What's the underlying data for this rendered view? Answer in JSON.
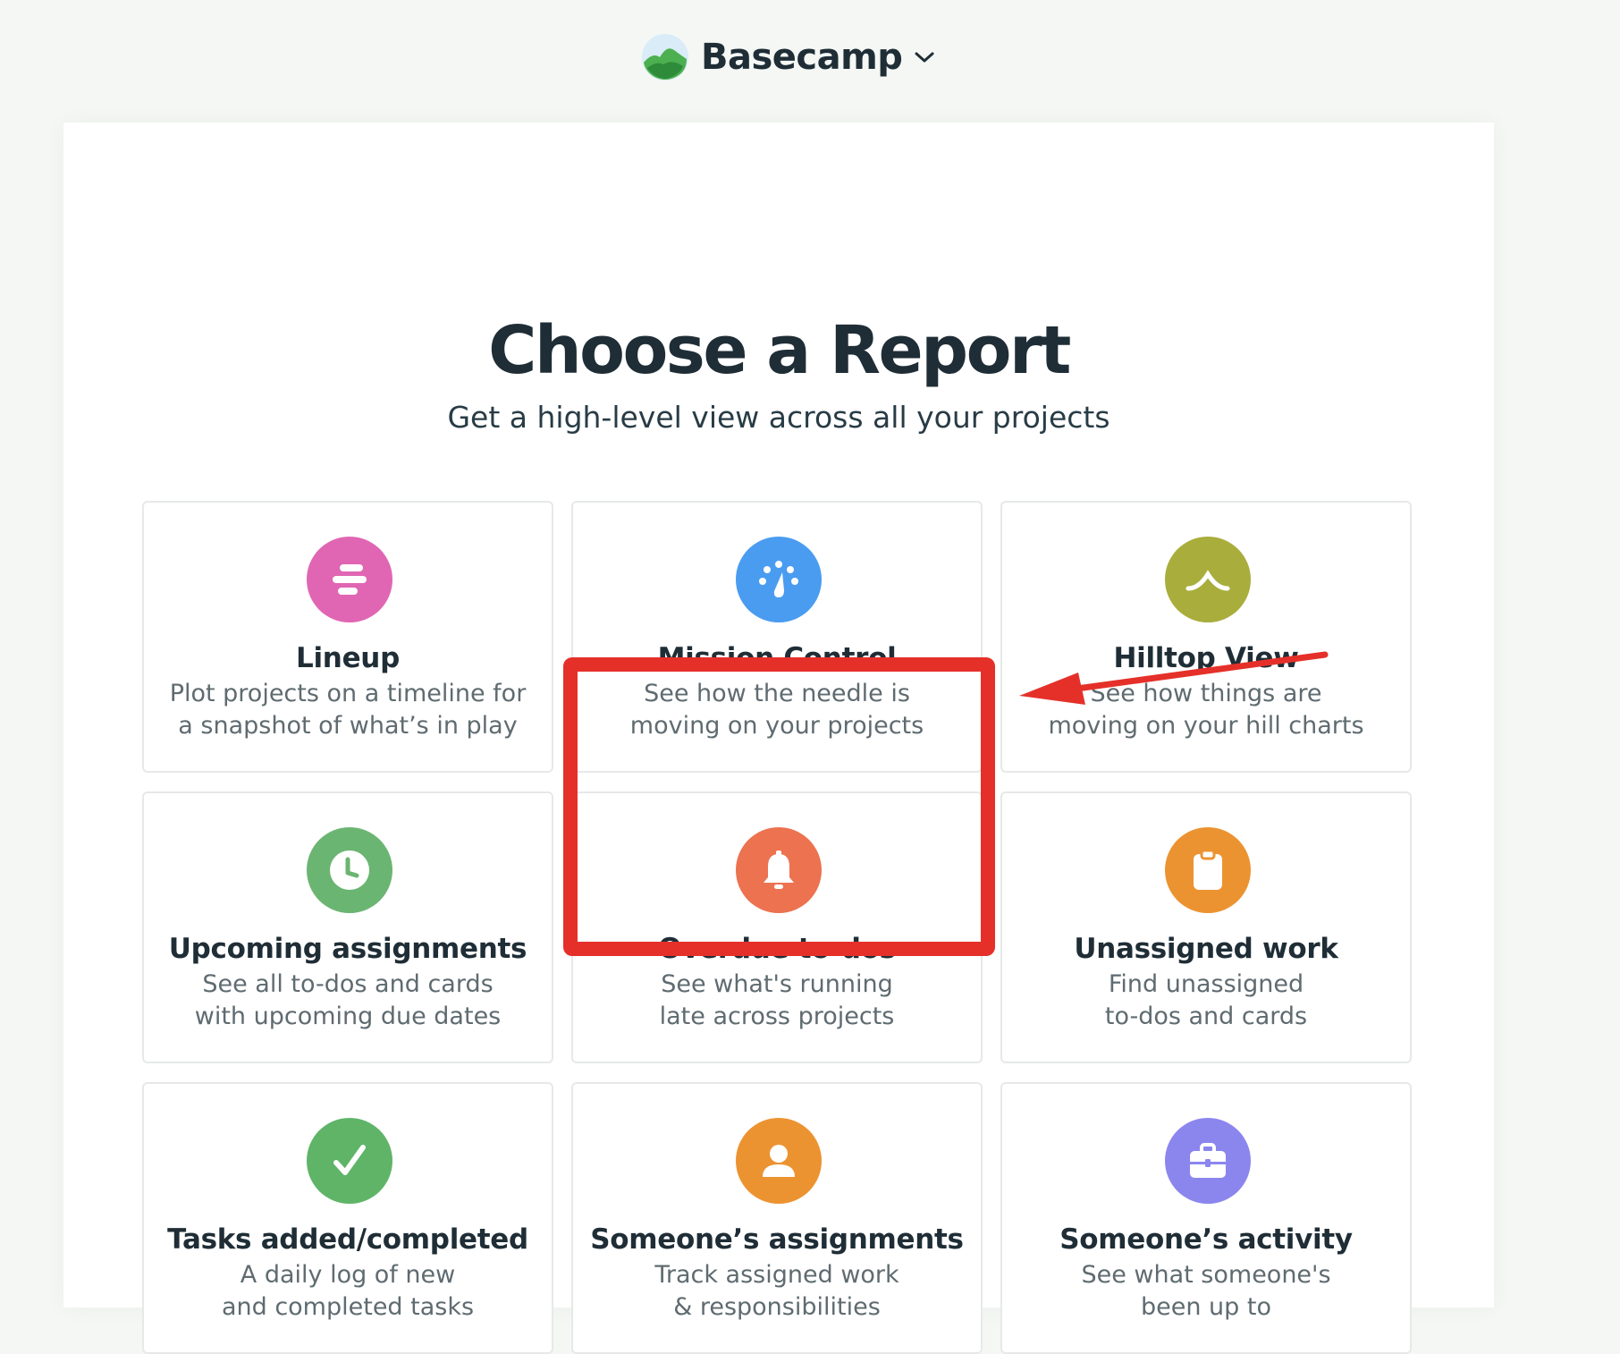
{
  "header": {
    "brand_name": "Basecamp"
  },
  "page": {
    "title": "Choose a Report",
    "subtitle": "Get a high-level view across all your projects"
  },
  "reports": [
    {
      "title": "Lineup",
      "desc_line1": "Plot projects on a timeline for",
      "desc_line2": "a snapshot of what’s in play",
      "icon": "lineup-icon",
      "color": "#e066b3"
    },
    {
      "title": "Mission Control",
      "desc_line1": "See how the needle is",
      "desc_line2": "moving on your projects",
      "icon": "gauge-icon",
      "color": "#4a9cf0"
    },
    {
      "title": "Hilltop View",
      "desc_line1": "See how things are",
      "desc_line2": "moving on your hill charts",
      "icon": "hill-icon",
      "color": "#a9ad3c"
    },
    {
      "title": "Upcoming assignments",
      "desc_line1": "See all to-dos and cards",
      "desc_line2": "with upcoming due dates",
      "icon": "clock-icon",
      "color": "#6bb572"
    },
    {
      "title": "Overdue to-dos",
      "desc_line1": "See what's running",
      "desc_line2": "late across projects",
      "icon": "bell-icon",
      "color": "#ec7250"
    },
    {
      "title": "Unassigned work",
      "desc_line1": "Find unassigned",
      "desc_line2": "to-dos and cards",
      "icon": "clipboard-icon",
      "color": "#ec9331"
    },
    {
      "title": "Tasks added/completed",
      "desc_line1": "A daily log of new",
      "desc_line2": "and completed tasks",
      "icon": "checkmark-icon",
      "color": "#5fb468"
    },
    {
      "title": "Someone’s assignments",
      "desc_line1": "Track assigned work",
      "desc_line2": "& responsibilities",
      "icon": "person-icon",
      "color": "#ec9331"
    },
    {
      "title": "Someone’s activity",
      "desc_line1": "See what someone's",
      "desc_line2": "been up to",
      "icon": "briefcase-icon",
      "color": "#8b86ee"
    }
  ],
  "annotation": {
    "highlight_color": "#e5302a"
  }
}
